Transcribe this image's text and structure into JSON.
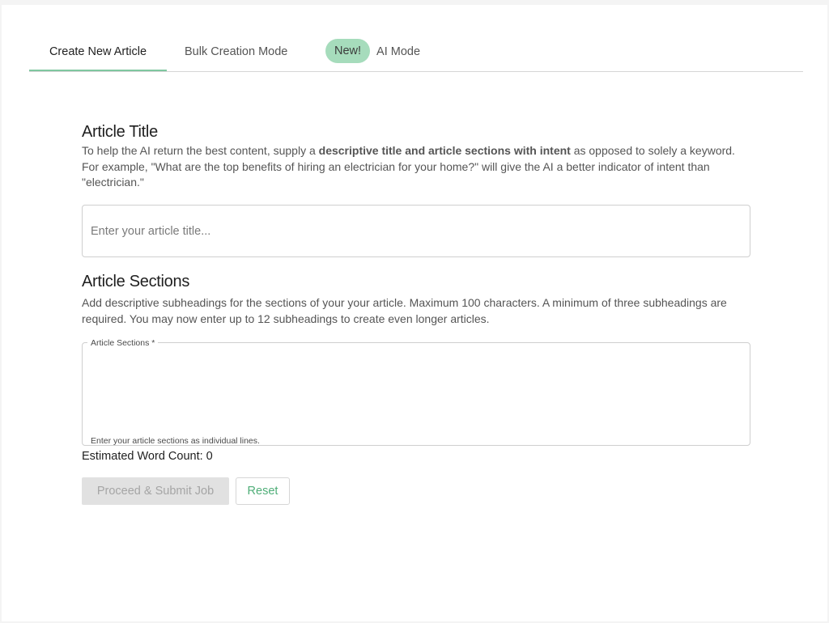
{
  "tabs": {
    "create_label": "Create New Article",
    "bulk_label": "Bulk Creation Mode",
    "ai_badge": "New!",
    "ai_label": "AI Mode"
  },
  "article_title": {
    "heading": "Article Title",
    "desc_before": "To help the AI return the best content, supply a ",
    "desc_bold": "descriptive title and article sections with intent",
    "desc_after": " as opposed to solely a keyword. For example, \"What are the top benefits of hiring an electrician for your home?\" will give the AI a better indicator of intent than \"electrician.\"",
    "input_value": "",
    "input_placeholder": "Enter your article title..."
  },
  "article_sections": {
    "heading": "Article Sections",
    "desc": "Add descriptive subheadings for the sections of your your article. Maximum 100 characters. A minimum of three subheadings are required. You may now enter up to 12 subheadings to create even longer articles.",
    "field_label": "Article Sections *",
    "field_value": "",
    "helper_text": "Enter your article sections as individual lines."
  },
  "word_count_label": "Estimated Word Count: 0",
  "buttons": {
    "submit_label": "Proceed & Submit Job",
    "reset_label": "Reset"
  },
  "colors": {
    "accent": "#7fc7a0",
    "badge_bg": "#a6dcbc",
    "reset_text": "#4fae78",
    "disabled_bg": "#e1e1e1"
  }
}
